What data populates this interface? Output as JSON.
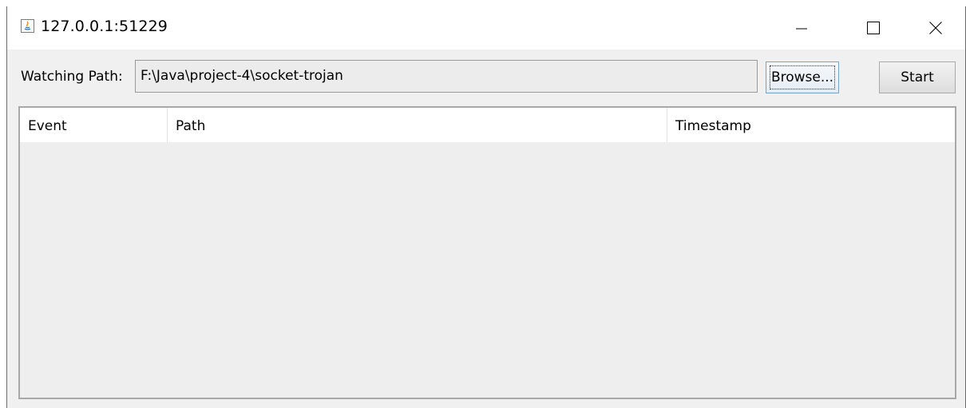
{
  "window": {
    "title": "127.0.0.1:51229",
    "icon": "java-icon",
    "controls": [
      "minimize-icon",
      "maximize-icon",
      "close-icon"
    ]
  },
  "watch": {
    "label": "Watching Path:",
    "path_value": "F:\\Java\\project-4\\socket-trojan"
  },
  "buttons": {
    "browse": "Browse...",
    "start": "Start"
  },
  "table": {
    "columns": [
      "Event",
      "Path",
      "Timestamp"
    ],
    "rows": []
  }
}
